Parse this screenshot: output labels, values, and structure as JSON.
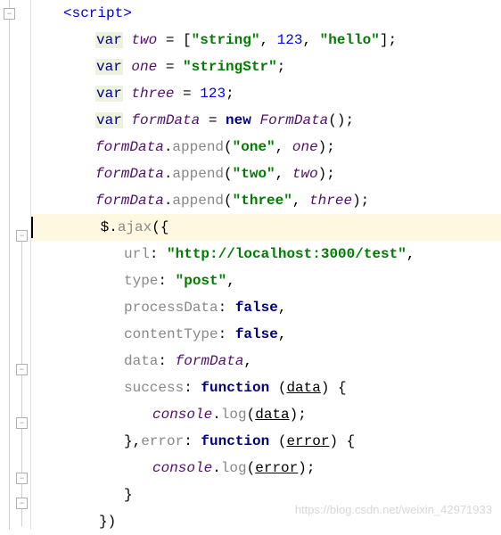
{
  "tag_open": "<script>",
  "lines": {
    "l1": {
      "kw": "var",
      "name": "two",
      "eq": " = [",
      "s1": "\"string\"",
      "c1": ", ",
      "n1": "123",
      "c2": ", ",
      "s2": "\"hello\"",
      "end": "];"
    },
    "l2": {
      "kw": "var",
      "name": "one",
      "eq": " = ",
      "s1": "\"stringStr\"",
      "end": ";"
    },
    "l3": {
      "kw": "var",
      "name": "three",
      "eq": " = ",
      "n1": "123",
      "end": ";"
    },
    "l4": {
      "kw": "var",
      "name": "formData",
      "eq": " = ",
      "new": "new",
      "cls": "FormData",
      "end": "();"
    },
    "l5": {
      "obj": "formData",
      "dot": ".",
      "method": "append",
      "open": "(",
      "s1": "\"one\"",
      "c1": ", ",
      "arg": "one",
      "end": ");"
    },
    "l6": {
      "obj": "formData",
      "dot": ".",
      "method": "append",
      "open": "(",
      "s1": "\"two\"",
      "c1": ", ",
      "arg": "two",
      "end": ");"
    },
    "l7": {
      "obj": "formData",
      "dot": ".",
      "method": "append",
      "open": "(",
      "s1": "\"three\"",
      "c1": ", ",
      "arg": "three",
      "end": ");"
    },
    "l8": {
      "dollar": " $.",
      "ajax": "ajax",
      "open": "({"
    },
    "l9": {
      "prop": "url",
      "colon": ": ",
      "val": "\"http://localhost:3000/test\"",
      "end": ","
    },
    "l10": {
      "prop": "type",
      "colon": ": ",
      "val": "\"post\"",
      "end": ","
    },
    "l11": {
      "prop": "processData",
      "colon": ": ",
      "val": "false",
      "end": ","
    },
    "l12": {
      "prop": "contentType",
      "colon": ": ",
      "val": "false",
      "end": ","
    },
    "l13": {
      "prop": "data",
      "colon": ": ",
      "val": "formData",
      "end": ","
    },
    "l14": {
      "prop": "success",
      "colon": ": ",
      "fn": "function",
      "open": " (",
      "param": "data",
      "close": ") {"
    },
    "l15": {
      "obj": "console",
      "dot": ".",
      "method": "log",
      "open": "(",
      "param": "data",
      "close": ");"
    },
    "l16": {
      "close": "},",
      "prop": "error",
      "colon": ": ",
      "fn": "function",
      "open": " (",
      "param": "error",
      "close2": ") {"
    },
    "l17": {
      "obj": "console",
      "dot": ".",
      "method": "log",
      "open": "(",
      "param": "error",
      "close": ");"
    },
    "l18": {
      "close": "}"
    },
    "l19": {
      "close": "})"
    }
  },
  "watermark": "https://blog.csdn.net/weixin_42971933"
}
